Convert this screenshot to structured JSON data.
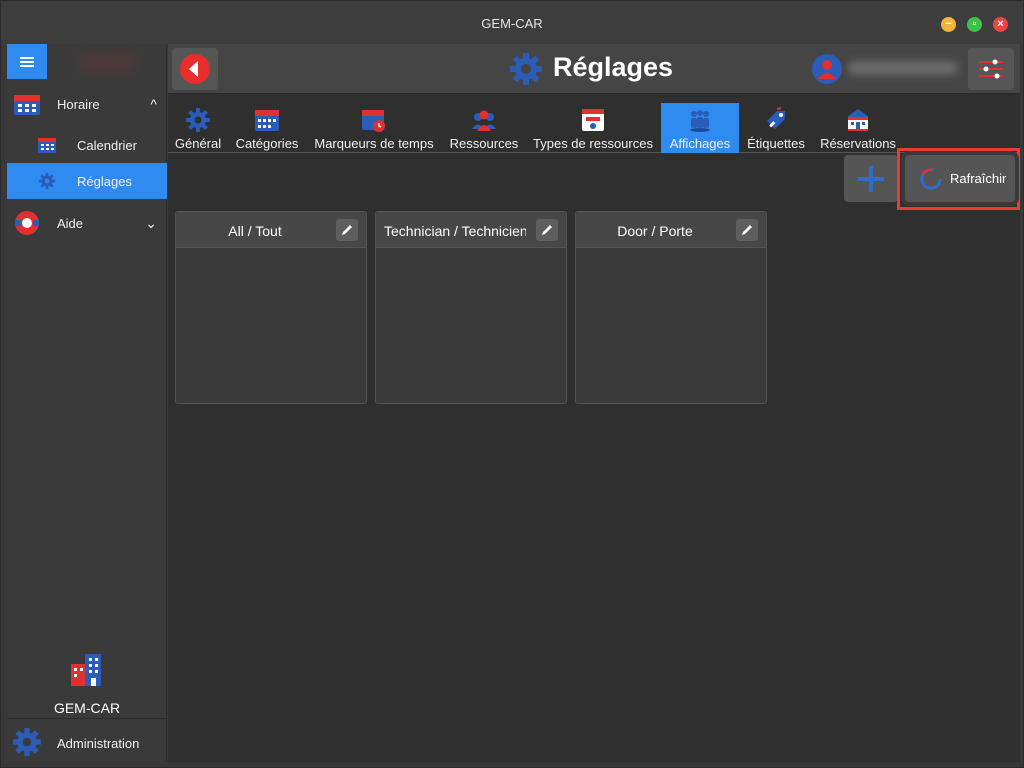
{
  "window": {
    "title": "GEM-CAR"
  },
  "colors": {
    "accent": "#2e8cf0",
    "brand_red": "#e03030",
    "brand_blue": "#2a5cb8",
    "highlight": "#ec3a3a"
  },
  "sidebar": {
    "items": [
      {
        "label": "Horaire",
        "icon": "calendar-icon",
        "chevron": "^"
      },
      {
        "label": "Calendrier",
        "icon": "calendar-small-icon"
      },
      {
        "label": "Réglages",
        "icon": "gear-icon"
      },
      {
        "label": "Aide",
        "icon": "lifebuoy-icon",
        "chevron": "⌄"
      }
    ],
    "brand_name": "GEM-CAR",
    "admin_label": "Administration"
  },
  "header": {
    "title": "Réglages"
  },
  "tabs": [
    {
      "label": "Général",
      "icon": "gear-icon"
    },
    {
      "label": "Catégories",
      "icon": "calendar-icon"
    },
    {
      "label": "Marqueurs de temps",
      "icon": "clock-calendar-icon"
    },
    {
      "label": "Ressources",
      "icon": "people-icon"
    },
    {
      "label": "Types de ressources",
      "icon": "id-card-icon"
    },
    {
      "label": "Affichages",
      "icon": "group-icon"
    },
    {
      "label": "Étiquettes",
      "icon": "tag-icon"
    },
    {
      "label": "Réservations",
      "icon": "building-icon"
    }
  ],
  "toolbar": {
    "refresh_label": "Rafraîchir"
  },
  "cards": [
    {
      "title": "All / Tout"
    },
    {
      "title": "Technician / Technicien"
    },
    {
      "title": "Door / Porte"
    }
  ]
}
